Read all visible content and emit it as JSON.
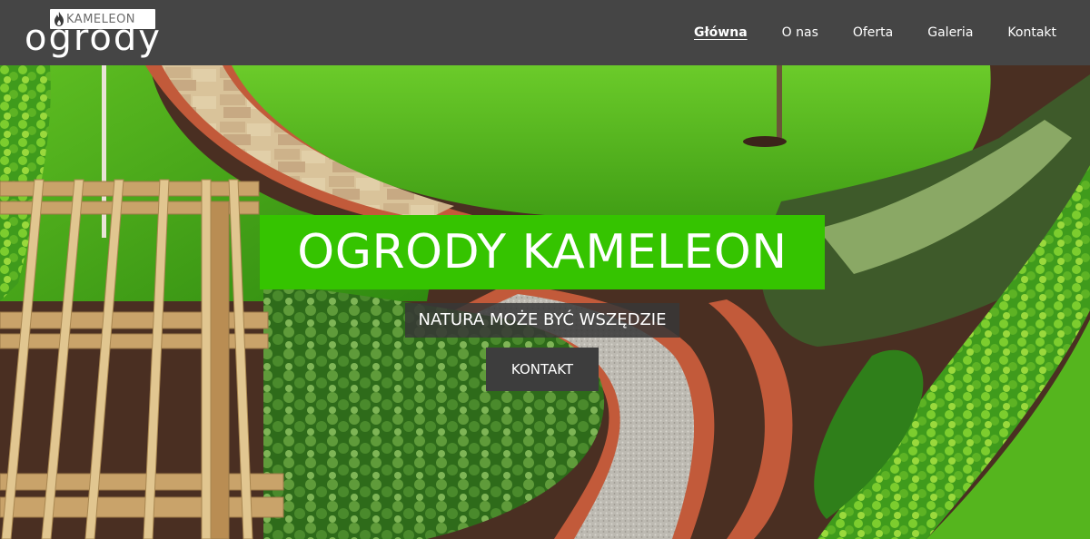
{
  "header": {
    "logo": {
      "badge_text": "KAMELEON",
      "word": "ogrody",
      "icon": "flame-icon"
    },
    "nav": [
      {
        "label": "Główna",
        "active": true
      },
      {
        "label": "O nas",
        "active": false
      },
      {
        "label": "Oferta",
        "active": false
      },
      {
        "label": "Galeria",
        "active": false
      },
      {
        "label": "Kontakt",
        "active": false
      }
    ]
  },
  "hero": {
    "title": "OGRODY KAMELEON",
    "subtitle": "NATURA MOŻE BYĆ WSZĘDZIE",
    "button_label": "KONTAKT",
    "background_image": "garden-path-photo"
  },
  "colors": {
    "header_bg": "#454545",
    "accent_green": "#35c400",
    "button_bg": "#3d3d3d",
    "text": "#ffffff"
  }
}
